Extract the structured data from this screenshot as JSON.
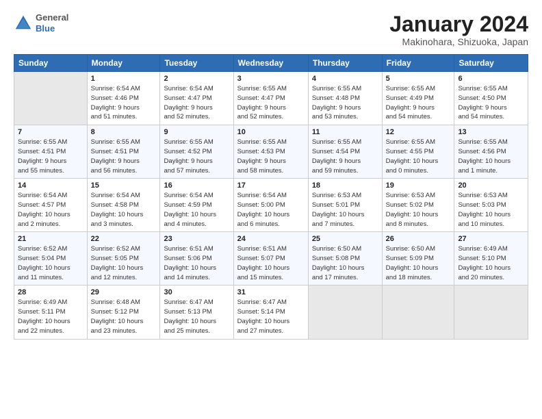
{
  "logo": {
    "line1": "General",
    "line2": "Blue"
  },
  "title": "January 2024",
  "subtitle": "Makinohara, Shizuoka, Japan",
  "weekdays": [
    "Sunday",
    "Monday",
    "Tuesday",
    "Wednesday",
    "Thursday",
    "Friday",
    "Saturday"
  ],
  "weeks": [
    [
      {
        "day": "",
        "info": ""
      },
      {
        "day": "1",
        "info": "Sunrise: 6:54 AM\nSunset: 4:46 PM\nDaylight: 9 hours\nand 51 minutes."
      },
      {
        "day": "2",
        "info": "Sunrise: 6:54 AM\nSunset: 4:47 PM\nDaylight: 9 hours\nand 52 minutes."
      },
      {
        "day": "3",
        "info": "Sunrise: 6:55 AM\nSunset: 4:47 PM\nDaylight: 9 hours\nand 52 minutes."
      },
      {
        "day": "4",
        "info": "Sunrise: 6:55 AM\nSunset: 4:48 PM\nDaylight: 9 hours\nand 53 minutes."
      },
      {
        "day": "5",
        "info": "Sunrise: 6:55 AM\nSunset: 4:49 PM\nDaylight: 9 hours\nand 54 minutes."
      },
      {
        "day": "6",
        "info": "Sunrise: 6:55 AM\nSunset: 4:50 PM\nDaylight: 9 hours\nand 54 minutes."
      }
    ],
    [
      {
        "day": "7",
        "info": "Sunrise: 6:55 AM\nSunset: 4:51 PM\nDaylight: 9 hours\nand 55 minutes."
      },
      {
        "day": "8",
        "info": "Sunrise: 6:55 AM\nSunset: 4:51 PM\nDaylight: 9 hours\nand 56 minutes."
      },
      {
        "day": "9",
        "info": "Sunrise: 6:55 AM\nSunset: 4:52 PM\nDaylight: 9 hours\nand 57 minutes."
      },
      {
        "day": "10",
        "info": "Sunrise: 6:55 AM\nSunset: 4:53 PM\nDaylight: 9 hours\nand 58 minutes."
      },
      {
        "day": "11",
        "info": "Sunrise: 6:55 AM\nSunset: 4:54 PM\nDaylight: 9 hours\nand 59 minutes."
      },
      {
        "day": "12",
        "info": "Sunrise: 6:55 AM\nSunset: 4:55 PM\nDaylight: 10 hours\nand 0 minutes."
      },
      {
        "day": "13",
        "info": "Sunrise: 6:55 AM\nSunset: 4:56 PM\nDaylight: 10 hours\nand 1 minute."
      }
    ],
    [
      {
        "day": "14",
        "info": "Sunrise: 6:54 AM\nSunset: 4:57 PM\nDaylight: 10 hours\nand 2 minutes."
      },
      {
        "day": "15",
        "info": "Sunrise: 6:54 AM\nSunset: 4:58 PM\nDaylight: 10 hours\nand 3 minutes."
      },
      {
        "day": "16",
        "info": "Sunrise: 6:54 AM\nSunset: 4:59 PM\nDaylight: 10 hours\nand 4 minutes."
      },
      {
        "day": "17",
        "info": "Sunrise: 6:54 AM\nSunset: 5:00 PM\nDaylight: 10 hours\nand 6 minutes."
      },
      {
        "day": "18",
        "info": "Sunrise: 6:53 AM\nSunset: 5:01 PM\nDaylight: 10 hours\nand 7 minutes."
      },
      {
        "day": "19",
        "info": "Sunrise: 6:53 AM\nSunset: 5:02 PM\nDaylight: 10 hours\nand 8 minutes."
      },
      {
        "day": "20",
        "info": "Sunrise: 6:53 AM\nSunset: 5:03 PM\nDaylight: 10 hours\nand 10 minutes."
      }
    ],
    [
      {
        "day": "21",
        "info": "Sunrise: 6:52 AM\nSunset: 5:04 PM\nDaylight: 10 hours\nand 11 minutes."
      },
      {
        "day": "22",
        "info": "Sunrise: 6:52 AM\nSunset: 5:05 PM\nDaylight: 10 hours\nand 12 minutes."
      },
      {
        "day": "23",
        "info": "Sunrise: 6:51 AM\nSunset: 5:06 PM\nDaylight: 10 hours\nand 14 minutes."
      },
      {
        "day": "24",
        "info": "Sunrise: 6:51 AM\nSunset: 5:07 PM\nDaylight: 10 hours\nand 15 minutes."
      },
      {
        "day": "25",
        "info": "Sunrise: 6:50 AM\nSunset: 5:08 PM\nDaylight: 10 hours\nand 17 minutes."
      },
      {
        "day": "26",
        "info": "Sunrise: 6:50 AM\nSunset: 5:09 PM\nDaylight: 10 hours\nand 18 minutes."
      },
      {
        "day": "27",
        "info": "Sunrise: 6:49 AM\nSunset: 5:10 PM\nDaylight: 10 hours\nand 20 minutes."
      }
    ],
    [
      {
        "day": "28",
        "info": "Sunrise: 6:49 AM\nSunset: 5:11 PM\nDaylight: 10 hours\nand 22 minutes."
      },
      {
        "day": "29",
        "info": "Sunrise: 6:48 AM\nSunset: 5:12 PM\nDaylight: 10 hours\nand 23 minutes."
      },
      {
        "day": "30",
        "info": "Sunrise: 6:47 AM\nSunset: 5:13 PM\nDaylight: 10 hours\nand 25 minutes."
      },
      {
        "day": "31",
        "info": "Sunrise: 6:47 AM\nSunset: 5:14 PM\nDaylight: 10 hours\nand 27 minutes."
      },
      {
        "day": "",
        "info": ""
      },
      {
        "day": "",
        "info": ""
      },
      {
        "day": "",
        "info": ""
      }
    ]
  ]
}
